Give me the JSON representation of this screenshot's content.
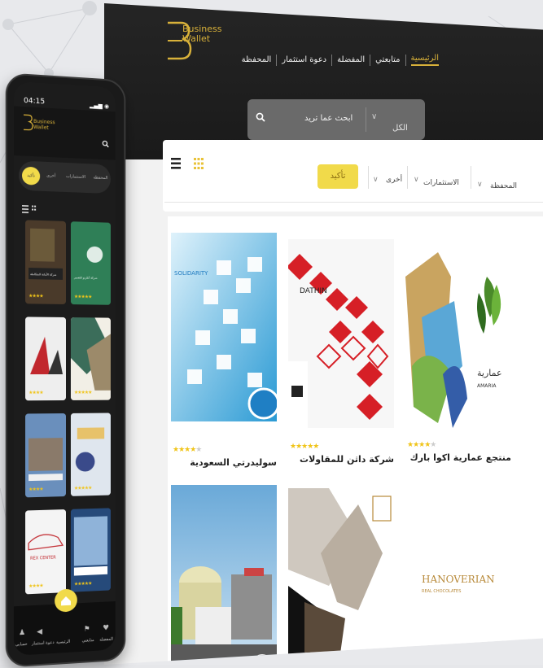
{
  "web": {
    "logo_line1": "Business",
    "logo_line2": "Wallet",
    "nav": [
      "الرئيسية",
      "متابعتي",
      "المفضلة",
      "دعوة استثمار",
      "المحفظة"
    ],
    "search": {
      "placeholder": "ابحث عما تريد",
      "scope": "الكل"
    },
    "filters": {
      "wallet": "المحفظة",
      "category": "الاستثمارات",
      "other": "أخرى",
      "confirm": "تأكيد"
    },
    "cards": [
      {
        "title": "منتجع عمارية اكوا بارك",
        "rating": 4
      },
      {
        "title": "شركة داثن للمقاولات",
        "rating": 5
      },
      {
        "title": "سوليدرتي السعودية",
        "rating": 4
      },
      {
        "title": "",
        "rating": 0
      },
      {
        "title": "",
        "rating": 0
      },
      {
        "title": "",
        "rating": 0
      }
    ],
    "card_labels": {
      "amaria_ar": "عمارية",
      "amaria_en": "AMARIA",
      "dathin": "DATHIN",
      "solidarity": "SOLIDARITY",
      "hanoverian": "HANOVERIAN",
      "hanoverian_sub": "REAL CHOCOLATES"
    }
  },
  "phone": {
    "time": "04:15",
    "logo_line1": "Business",
    "logo_line2": "Wallet",
    "filter_confirm": "تأكيد",
    "filter_items": [
      "أخرى",
      "الاستثمارات",
      "المحفظة"
    ],
    "tabs": [
      "حسابي",
      "دعوة استثمار",
      "الرئيسية",
      "متابعتي",
      "المفضلة"
    ],
    "card_labels": {
      "card1": "شركة الأمانة المتكاملة",
      "card2": "شركة أنكرنو للتعمير",
      "rexcenter": "REX CENTER"
    }
  },
  "colors": {
    "accent": "#f1da4a",
    "gold": "#d8b13a",
    "header_bg": "#1a1a1a",
    "star": "#f0c419"
  }
}
